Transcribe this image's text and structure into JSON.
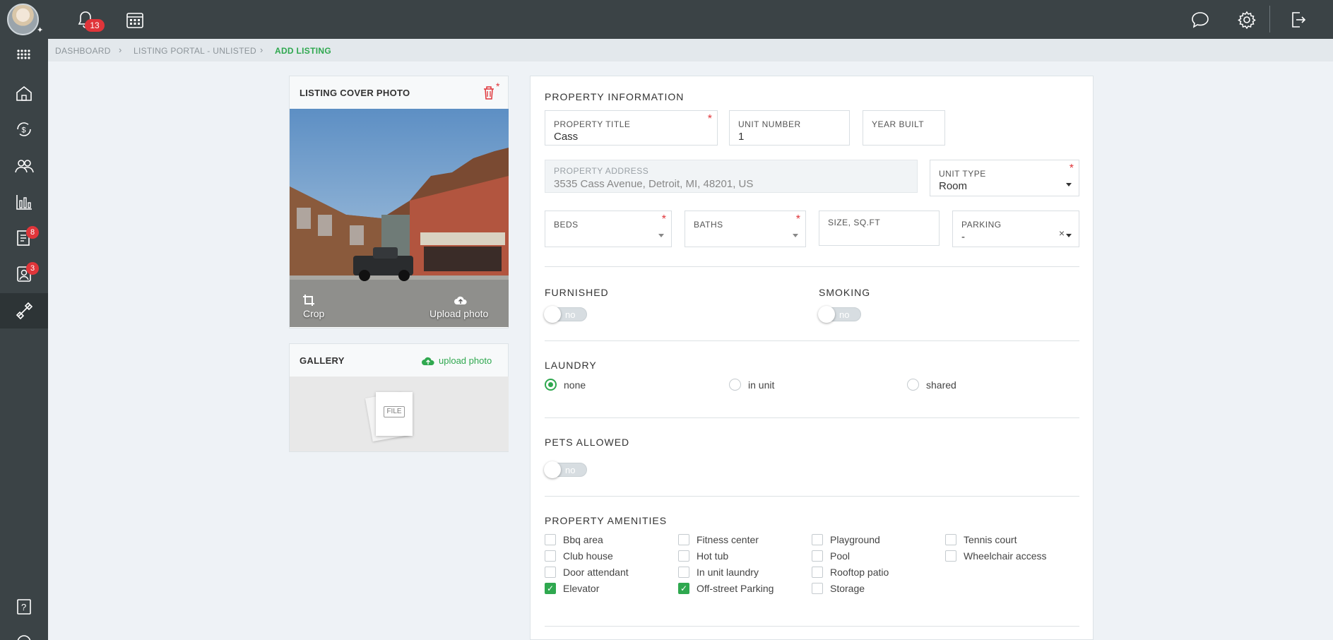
{
  "topbar": {
    "notification_count": "13",
    "icons": [
      "bell-icon",
      "calendar-icon",
      "chat-icon",
      "gear-icon",
      "logout-icon"
    ]
  },
  "sidebar": {
    "items": [
      {
        "name": "apps-grid-icon",
        "badge": null
      },
      {
        "name": "home-icon",
        "badge": null
      },
      {
        "name": "money-cycle-icon",
        "badge": null
      },
      {
        "name": "people-icon",
        "badge": null
      },
      {
        "name": "analytics-icon",
        "badge": null
      },
      {
        "name": "document-icon",
        "badge": "8"
      },
      {
        "name": "contact-icon",
        "badge": "3"
      },
      {
        "name": "listing-tool-icon",
        "badge": null
      }
    ],
    "bottom": [
      "help-icon",
      "support-headset-icon"
    ]
  },
  "breadcrumb": {
    "items": [
      "DASHBOARD",
      "LISTING PORTAL - UNLISTED",
      "ADD LISTING"
    ]
  },
  "cover_photo": {
    "title": "LISTING COVER PHOTO",
    "crop_label": "Crop",
    "upload_label": "Upload photo"
  },
  "gallery": {
    "title": "GALLERY",
    "upload_label": "upload photo",
    "file_label": "FILE"
  },
  "property_info": {
    "title": "PROPERTY INFORMATION",
    "property_title": {
      "label": "PROPERTY TITLE",
      "value": "Cass"
    },
    "unit_number": {
      "label": "UNIT NUMBER",
      "value": "1"
    },
    "year_built": {
      "label": "YEAR BUILT",
      "value": ""
    },
    "address": {
      "label": "PROPERTY ADDRESS",
      "value": "3535 Cass Avenue, Detroit, MI, 48201, US"
    },
    "unit_type": {
      "label": "UNIT TYPE",
      "value": "Room"
    },
    "beds": {
      "label": "BEDS",
      "value": ""
    },
    "baths": {
      "label": "BATHS",
      "value": ""
    },
    "size": {
      "label": "SIZE, SQ.FT",
      "value": ""
    },
    "parking": {
      "label": "PARKING",
      "value": "-"
    }
  },
  "furnished": {
    "title": "FURNISHED",
    "value": "no"
  },
  "smoking": {
    "title": "SMOKING",
    "value": "no"
  },
  "laundry": {
    "title": "LAUNDRY",
    "options": [
      "none",
      "in unit",
      "shared"
    ],
    "selected": "none"
  },
  "pets": {
    "title": "PETS ALLOWED",
    "value": "no"
  },
  "amenities": {
    "title": "PROPERTY AMENITIES",
    "items": [
      {
        "label": "Bbq area",
        "checked": false
      },
      {
        "label": "Club house",
        "checked": false
      },
      {
        "label": "Door attendant",
        "checked": false
      },
      {
        "label": "Elevator",
        "checked": true
      },
      {
        "label": "Fitness center",
        "checked": false
      },
      {
        "label": "Hot tub",
        "checked": false
      },
      {
        "label": "In unit laundry",
        "checked": false
      },
      {
        "label": "Off-street Parking",
        "checked": true
      },
      {
        "label": "Playground",
        "checked": false
      },
      {
        "label": "Pool",
        "checked": false
      },
      {
        "label": "Rooftop patio",
        "checked": false
      },
      {
        "label": "Storage",
        "checked": false
      },
      {
        "label": "Tennis court",
        "checked": false
      },
      {
        "label": "Wheelchair access",
        "checked": false
      }
    ]
  },
  "colors": {
    "accent": "#2fa84f",
    "danger": "#e0353a",
    "nav": "#3b4346"
  }
}
